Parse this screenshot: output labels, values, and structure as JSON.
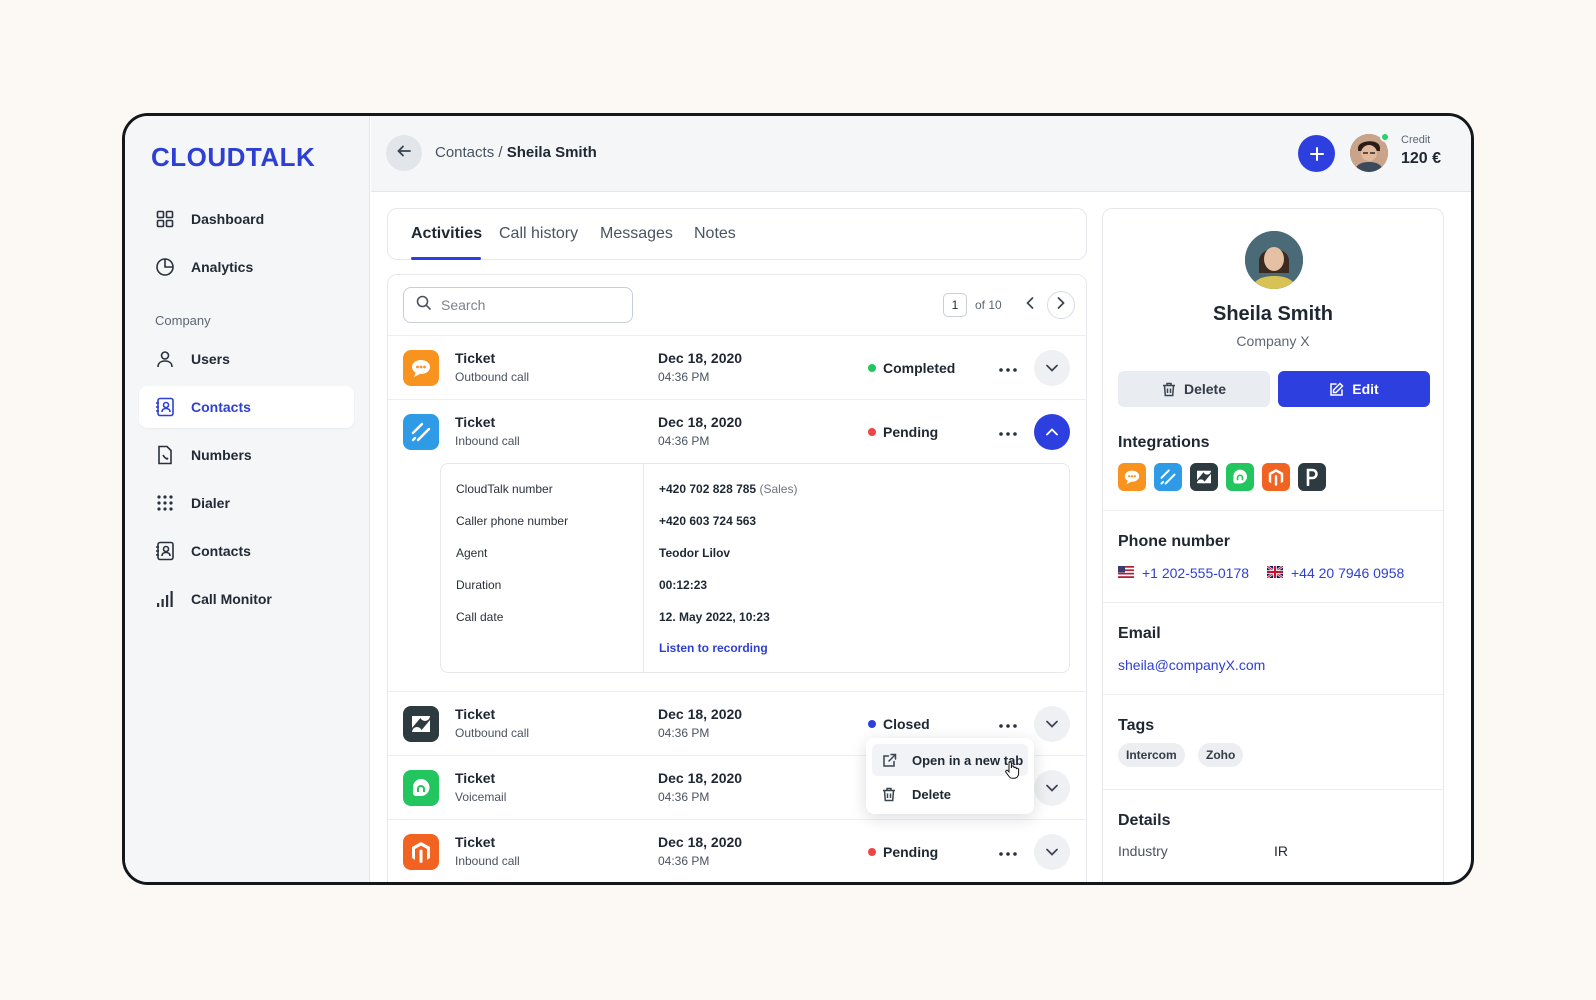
{
  "brand": {
    "logo": "CLOUDTALK",
    "accent": "#2e3fe0"
  },
  "sidebar": {
    "items": [
      {
        "label": "Dashboard",
        "icon": "grid-icon"
      },
      {
        "label": "Analytics",
        "icon": "pie-chart-icon"
      },
      {
        "label": "Users",
        "icon": "user-icon"
      },
      {
        "label": "Contacts",
        "icon": "contact-book-icon",
        "active": true
      },
      {
        "label": "Numbers",
        "icon": "phone-file-icon"
      },
      {
        "label": "Dialer",
        "icon": "dialpad-icon"
      },
      {
        "label": "Contacts",
        "icon": "contact-book-icon"
      },
      {
        "label": "Call Monitor",
        "icon": "bar-chart-icon"
      }
    ],
    "section_label": "Company"
  },
  "topbar": {
    "breadcrumb_parent": "Contacts",
    "breadcrumb_sep": "/",
    "breadcrumb_current": "Sheila Smith",
    "credit_label": "Credit",
    "credit_value": "120 €"
  },
  "tabs": [
    {
      "label": "Activities",
      "active": true
    },
    {
      "label": "Call history"
    },
    {
      "label": "Messages"
    },
    {
      "label": "Notes"
    }
  ],
  "search": {
    "placeholder": "Search"
  },
  "pagination": {
    "current": "1",
    "of_label": "of 10"
  },
  "activities": [
    {
      "title": "Ticket",
      "type": "Outbound call",
      "date": "Dec 18, 2020",
      "time": "04:36 PM",
      "status": "Completed",
      "status_color": "#22c55e",
      "app": "chat-bubble-icon",
      "app_color": "#f7931e"
    },
    {
      "title": "Ticket",
      "type": "Inbound call",
      "date": "Dec 18, 2020",
      "time": "04:36 PM",
      "status": "Pending",
      "status_color": "#ef4444",
      "app": "slash-lines-icon",
      "app_color": "#2f9be6",
      "expanded": true
    },
    {
      "title": "Ticket",
      "type": "Outbound call",
      "date": "Dec 18, 2020",
      "time": "04:36 PM",
      "status": "Closed",
      "status_color": "#2e3fe0",
      "app": "zendesk-icon",
      "app_color": "#2d3a3f"
    },
    {
      "title": "Ticket",
      "type": "Voicemail",
      "date": "Dec 18, 2020",
      "time": "04:36 PM",
      "status": "",
      "app": "freshdesk-icon",
      "app_color": "#22c55e"
    },
    {
      "title": "Ticket",
      "type": "Inbound call",
      "date": "Dec 18, 2020",
      "time": "04:36 PM",
      "status": "Pending",
      "status_color": "#ef4444",
      "app": "magento-icon",
      "app_color": "#f26322"
    }
  ],
  "call_details": {
    "rows": [
      {
        "label": "CloudTalk number",
        "value": "+420 702 828 785",
        "note": "(Sales)"
      },
      {
        "label": "Caller phone number",
        "value": "+420 603 724 563"
      },
      {
        "label": "Agent",
        "value": "Teodor Lilov"
      },
      {
        "label": "Duration",
        "value": "00:12:23"
      },
      {
        "label": "Call date",
        "value": "12. May 2022, 10:23"
      }
    ],
    "link": "Listen to recording"
  },
  "context_menu": {
    "open_label": "Open in a new tab",
    "delete_label": "Delete"
  },
  "profile": {
    "name": "Sheila Smith",
    "company": "Company X",
    "delete_label": "Delete",
    "edit_label": "Edit",
    "integrations_title": "Integrations",
    "integrations": [
      {
        "icon": "chat-bubble-icon",
        "color": "#f7931e"
      },
      {
        "icon": "slash-lines-icon",
        "color": "#2f9be6"
      },
      {
        "icon": "zendesk-icon",
        "color": "#2d3a3f"
      },
      {
        "icon": "freshdesk-icon",
        "color": "#22c55e"
      },
      {
        "icon": "magento-icon",
        "color": "#f26322"
      },
      {
        "icon": "pipedrive-icon",
        "color": "#2d3a3f"
      }
    ],
    "phone_title": "Phone number",
    "phones": [
      {
        "flag": "us-flag-icon",
        "number": "+1 202-555-0178"
      },
      {
        "flag": "uk-flag-icon",
        "number": "+44 20 7946 0958"
      }
    ],
    "email_title": "Email",
    "email": "sheila@companyX.com",
    "tags_title": "Tags",
    "tags": [
      "Intercom",
      "Zoho"
    ],
    "details_title": "Details",
    "industry_label": "Industry",
    "industry_value": "IR"
  }
}
